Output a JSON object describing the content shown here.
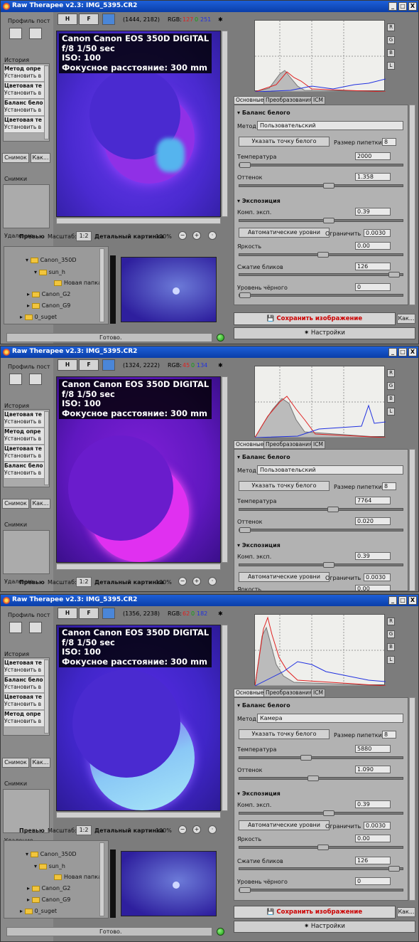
{
  "app": {
    "title": "Raw Therapee v2.3: IMG_5395.CR2"
  },
  "window_buttons": {
    "minimize": "_",
    "maximize": "□",
    "close": "X"
  },
  "left": {
    "profile_label": "Профиль пост",
    "history_label": "История",
    "snapshots_label": "Снимки",
    "snapshot_btn": "Снимок",
    "snapshot_btn2": "Как..."
  },
  "toolbar": {
    "h_label": "H",
    "f_label": "F",
    "preview_label": "Превью",
    "scale_label": "Масштаб:",
    "scale_value": "1:2",
    "detail_label": "Детальный картинка",
    "percent": "100%",
    "remove_label": "Удаление"
  },
  "exif": {
    "camera": "Canon Canon EOS 350D DIGITAL",
    "exposure": "f/8 1/50 sec",
    "iso": "ISO: 100",
    "focal": "Фокусное расстояние: 300 mm"
  },
  "histogram_buttons": [
    "R",
    "G",
    "B",
    "L"
  ],
  "tabs": {
    "main": "Основные",
    "transform": "Преобразования",
    "icm": "ICM"
  },
  "wb": {
    "section": "Баланс белого",
    "method_label": "Метод",
    "pick_button": "Указать точку белого",
    "pipette_label": "Размер пипетки:",
    "pipette_value": "8",
    "temp_label": "Температура",
    "tint_label": "Оттенок"
  },
  "exposure": {
    "section": "Экспозиция",
    "comp_label": "Комп. эксп.",
    "auto_button": "Автоматические уровни",
    "clip_label": "Ограничить",
    "clip_value": "0.0030",
    "brightness_label": "Яркость",
    "highlight_label": "Сжатие бликов",
    "black_label": "Уровень чёрного"
  },
  "bottom": {
    "save": "Сохранить изображение",
    "as": "Как...",
    "settings": "Настройки",
    "status": "Готово."
  },
  "tree": {
    "f1": "Canon_350D",
    "f2": "sun_h",
    "f3": "Новая папка",
    "f4": "Canon_G2",
    "f5": "Canon_G9",
    "f6": "0_suget"
  },
  "history_items": [
    {
      "title": "Метод опре",
      "sub": "Установить в"
    },
    {
      "title": "Цветовая те",
      "sub": "Установить в"
    },
    {
      "title": "Баланс бело",
      "sub": "Установить в"
    },
    {
      "title": "Цветовая те",
      "sub": "Установить в"
    }
  ],
  "history_items3": [
    {
      "title": "Цветовая те",
      "sub": "Установить в"
    },
    {
      "title": "Баланс бело",
      "sub": "Установить в"
    },
    {
      "title": "Цветовая те",
      "sub": "Установить в"
    },
    {
      "title": "Метод опре",
      "sub": "Установить в"
    }
  ],
  "windows": [
    {
      "coords": "(1444, 2182)",
      "rgb_r": "127",
      "rgb_g": "0",
      "rgb_b": "251",
      "method": "Пользовательский",
      "temp": "2000",
      "tint": "1.358",
      "comp": "0.39",
      "brightness": "0.00",
      "highlight": "126",
      "black": "0"
    },
    {
      "coords": "(1324, 2222)",
      "rgb_r": "45",
      "rgb_g": "0",
      "rgb_b": "134",
      "method": "Пользовательский",
      "temp": "7764",
      "tint": "0.020",
      "comp": "0.39",
      "brightness": "0.00"
    },
    {
      "coords": "(1356, 2238)",
      "rgb_r": "62",
      "rgb_g": "0",
      "rgb_b": "182",
      "method": "Камера",
      "temp": "5880",
      "tint": "1.090",
      "comp": "0.39",
      "brightness": "0.00",
      "highlight": "126",
      "black": "0"
    }
  ],
  "rgb_prefix": "RGB:",
  "colors": {
    "title_bar": "#0a3ea8",
    "panel": "#b2b2b2",
    "r": "#e02020",
    "g": "#10a010",
    "b": "#2030e0"
  }
}
